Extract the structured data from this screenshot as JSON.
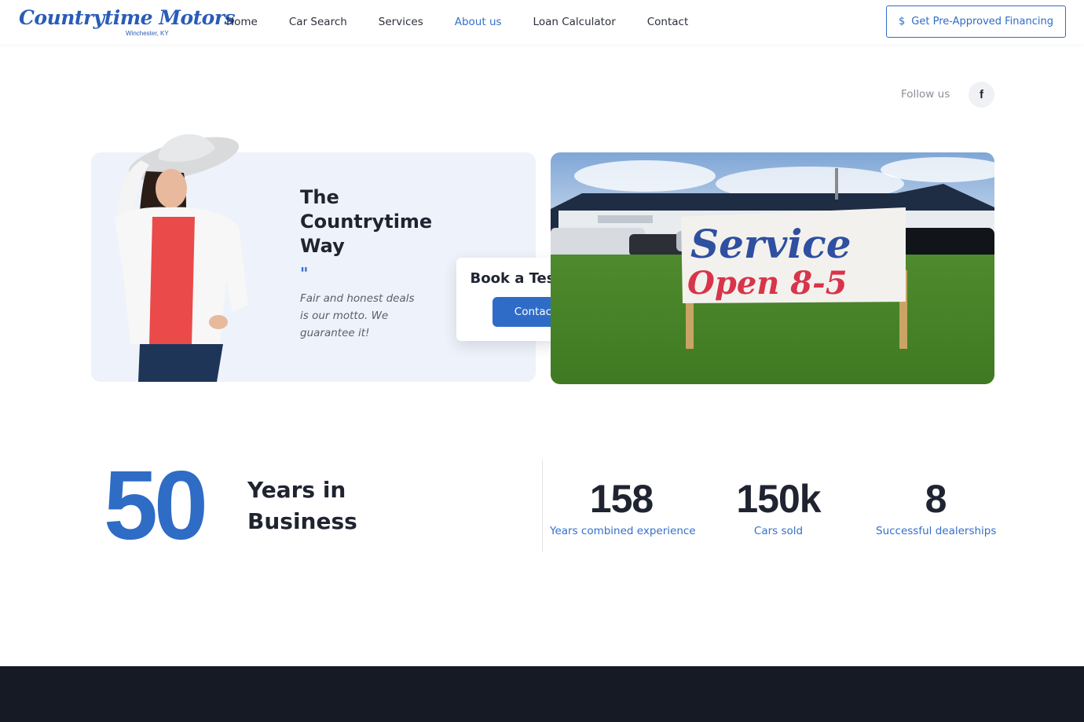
{
  "header": {
    "logo_text": "Countrytime Motors",
    "logo_sub": "Winchester, KY",
    "nav": [
      "Home",
      "Car Search",
      "Services",
      "About us",
      "Loan Calculator",
      "Contact"
    ],
    "active_nav": "About us",
    "cta_label": "Get Pre-Approved Financing",
    "cta_icon": "dollar-icon"
  },
  "social": {
    "follow_label": "Follow us",
    "facebook_glyph": "f"
  },
  "hero": {
    "headline": "The Countrytime Way",
    "quote_mark": "\"",
    "motto": "Fair and honest deals is our motto. We guarantee it!",
    "book_title": "Book a Test Drive!",
    "book_button": "Contact us",
    "sign_line1": "Service",
    "sign_line2": "Open 8-5"
  },
  "stats": {
    "years_number": "50",
    "years_label": "Years in Business",
    "items": [
      {
        "value": "158",
        "label": "Years combined experience"
      },
      {
        "value": "150k",
        "label": "Cars sold"
      },
      {
        "value": "8",
        "label": "Successful dealerships"
      }
    ]
  },
  "colors": {
    "accent": "#2f6cc8",
    "text": "#1f2430",
    "card_bg": "#eef2fa",
    "footer_bg": "#151a24"
  }
}
